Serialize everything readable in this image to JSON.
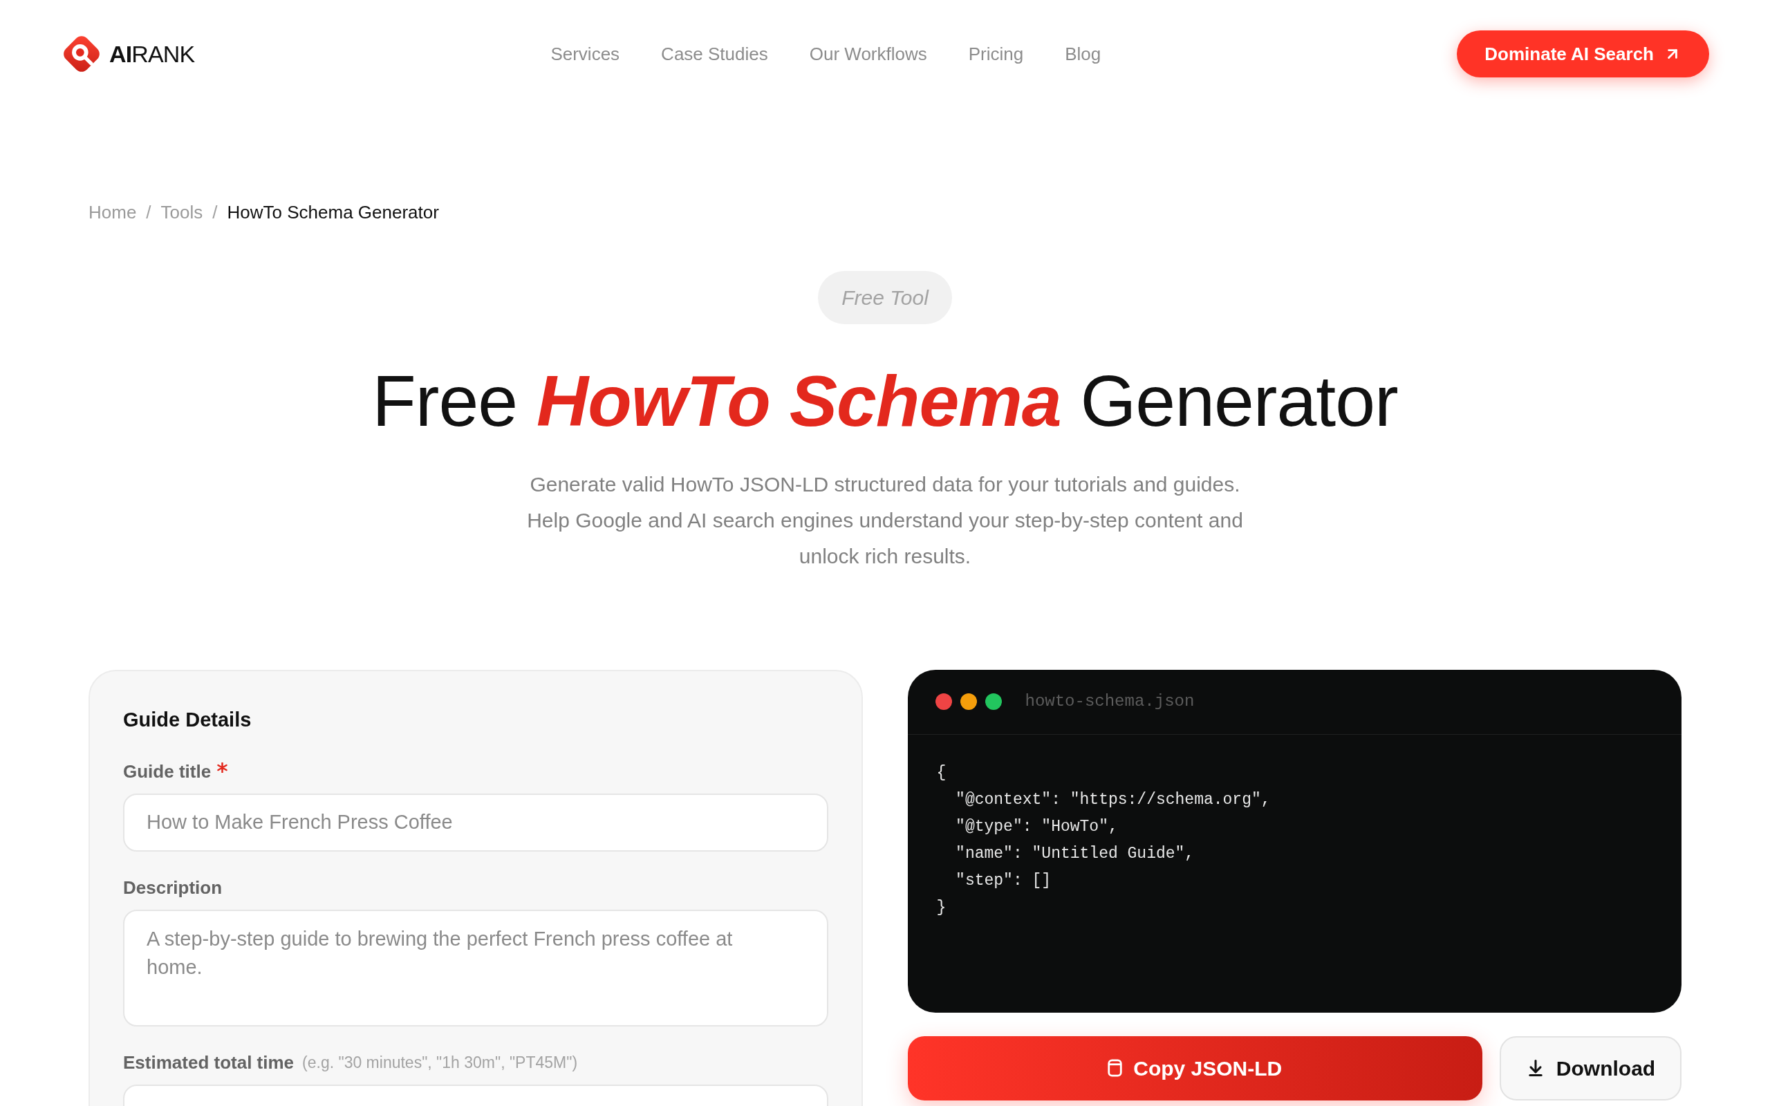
{
  "header": {
    "logo": {
      "mark": "AI",
      "word": "RANK"
    },
    "nav": [
      "Services",
      "Case Studies",
      "Our Workflows",
      "Pricing",
      "Blog"
    ],
    "cta": {
      "label": "Dominate AI Search"
    }
  },
  "breadcrumb": {
    "separator": "/",
    "items": [
      {
        "label": "Home",
        "current": false
      },
      {
        "label": "Tools",
        "current": false
      },
      {
        "label": "HowTo Schema Generator",
        "current": true
      }
    ]
  },
  "hero": {
    "badge": "Free Tool",
    "title": "Free **HowTo Schema** Generator",
    "subtitle": "Generate valid HowTo JSON-LD structured data for your tutorials and guides. Help Google and AI search engines understand your step-by-step content and unlock rich results."
  },
  "form": {
    "title": "Guide Details",
    "fields": [
      {
        "kind": "input",
        "label": "Guide title",
        "required": true,
        "placeholder": "How to Make French Press Coffee"
      },
      {
        "kind": "textarea",
        "label": "Description",
        "required": false,
        "placeholder": "A step-by-step guide to brewing the perfect French press coffee at home."
      },
      {
        "kind": "input",
        "label": "Estimated total time",
        "required": false,
        "hint": "(e.g. \"30 minutes\", \"1h 30m\", \"PT45M\")"
      }
    ]
  },
  "preview": {
    "filename": "howto-schema.json",
    "code": [
      "{",
      "  \"@context\": \"https://schema.org\",",
      "  \"@type\": \"HowTo\",",
      "  \"name\": \"Untitled Guide\",",
      "  \"step\": []",
      "}"
    ]
  },
  "actions": [
    {
      "kind": "copy",
      "label": "Copy JSON-LD"
    },
    {
      "kind": "download",
      "label": "Download"
    }
  ]
}
